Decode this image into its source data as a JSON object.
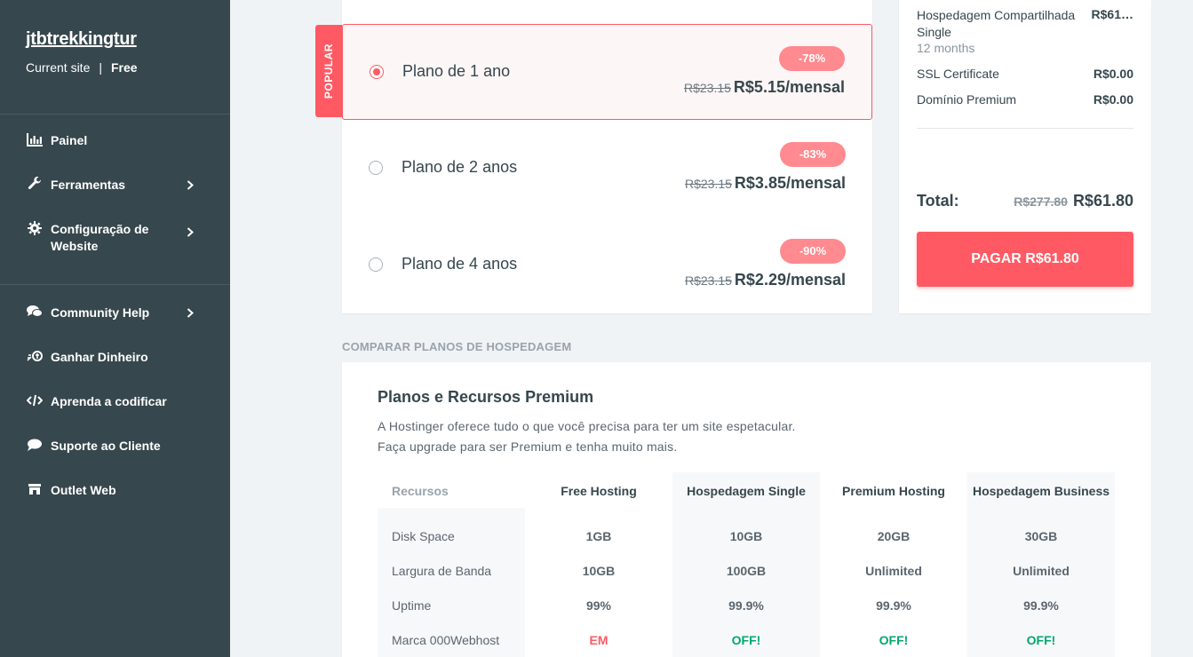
{
  "sidebar": {
    "site_name": "jtbtrekkingtur",
    "site_label": "Current site",
    "separator": "|",
    "site_plan": "Free",
    "items": [
      {
        "label": "Painel",
        "icon": "bar-chart-icon"
      },
      {
        "label": "Ferramentas",
        "icon": "wrench-icon"
      },
      {
        "label": "Configuração de Website",
        "icon": "gear-icon"
      },
      {
        "label": "Community Help",
        "icon": "chat-bubbles-icon"
      },
      {
        "label": "Ganhar Dinheiro",
        "icon": "referral-icon"
      },
      {
        "label": "Aprenda a codificar",
        "icon": "code-icon"
      },
      {
        "label": "Suporte ao Cliente",
        "icon": "speech-bubble-icon"
      },
      {
        "label": "Outlet Web",
        "icon": "store-icon"
      }
    ]
  },
  "plans": {
    "popular_label": "POPULAR",
    "options": [
      {
        "name": "Plano de 1 ano",
        "discount": "-78%",
        "old_price": "R$23.15",
        "price": "R$5.15/mensal",
        "selected": true
      },
      {
        "name": "Plano de 2 anos",
        "discount": "-83%",
        "old_price": "R$23.15",
        "price": "R$3.85/mensal",
        "selected": false
      },
      {
        "name": "Plano de 4 anos",
        "discount": "-90%",
        "old_price": "R$23.15",
        "price": "R$2.29/mensal",
        "selected": false
      }
    ]
  },
  "summary": {
    "product": "Hospedagem Compartilhada Single",
    "product_price": "R$61…",
    "period": "12 months",
    "ssl_label": "SSL Certificate",
    "ssl_price": "R$0.00",
    "domain_label": "Domínio Premium",
    "domain_price": "R$0.00",
    "total_label": "Total:",
    "total_old": "R$277.80",
    "total_new": "R$61.80",
    "pay_button": "PAGAR R$61.80"
  },
  "compare": {
    "section_heading": "COMPARAR PLANOS DE HOSPEDAGEM",
    "title": "Planos e Recursos Premium",
    "desc_line1": "A Hostinger oferece tudo o que você precisa para ter um site espetacular.",
    "desc_line2": "Faça upgrade para ser Premium e tenha muito mais.",
    "headers": [
      "Recursos",
      "Free Hosting",
      "Hospedagem Single",
      "Premium Hosting",
      "Hospedagem Business"
    ],
    "rows": [
      {
        "label": "Disk Space",
        "values": [
          "1GB",
          "10GB",
          "20GB",
          "30GB"
        ]
      },
      {
        "label": "Largura de Banda",
        "values": [
          "10GB",
          "100GB",
          "Unlimited",
          "Unlimited"
        ]
      },
      {
        "label": "Uptime",
        "values": [
          "99%",
          "99.9%",
          "99.9%",
          "99.9%"
        ]
      },
      {
        "label": "Marca 000Webhost",
        "values": [
          "EM",
          "OFF!",
          "OFF!",
          "OFF!"
        ]
      }
    ]
  },
  "colors": {
    "accent": "#ff5a64",
    "sidebar_bg": "#36474d",
    "success": "#00a86b"
  }
}
